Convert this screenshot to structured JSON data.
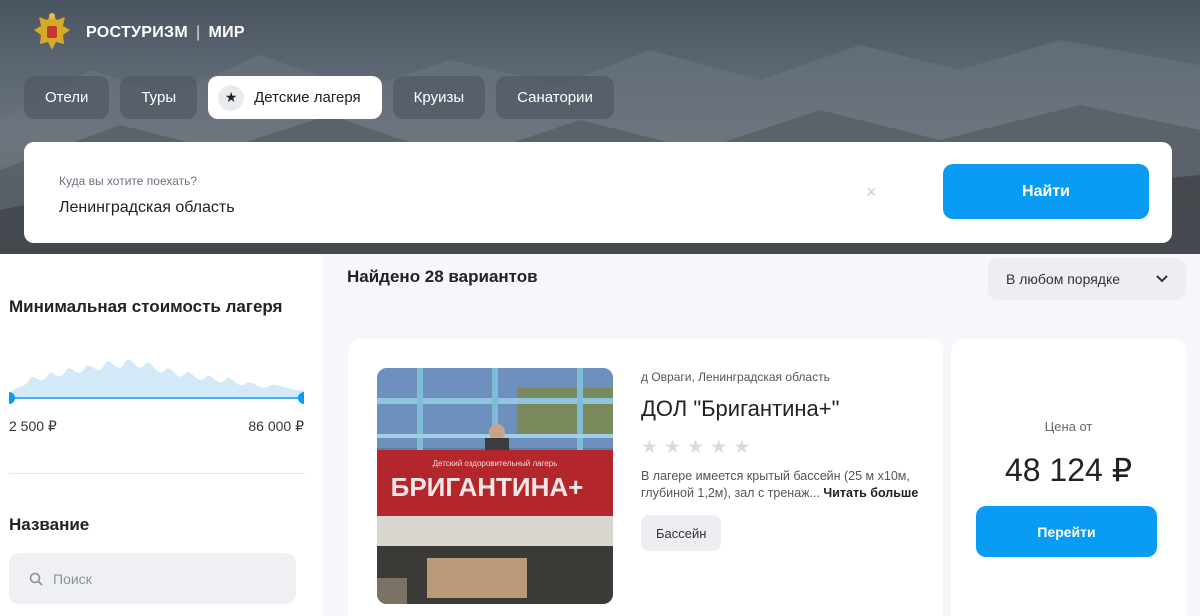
{
  "brand": {
    "name": "РОСТУРИЗМ",
    "partner": "МИР",
    "separator": "|"
  },
  "tabs": [
    {
      "label": "Отели",
      "active": false
    },
    {
      "label": "Туры",
      "active": false
    },
    {
      "label": "Детские лагеря",
      "active": true
    },
    {
      "label": "Круизы",
      "active": false
    },
    {
      "label": "Санатории",
      "active": false
    }
  ],
  "search": {
    "label": "Куда вы хотите поехать?",
    "value": "Ленинградская область",
    "clear_icon": "close-icon",
    "button_label": "Найти"
  },
  "filters": {
    "price_title": "Минимальная стоимость лагеря",
    "price_min": "2 500 ₽",
    "price_max": "86 000 ₽",
    "name_title": "Название",
    "name_placeholder": "Поиск"
  },
  "results": {
    "found_text": "Найдено 28 вариантов",
    "sort_label": "В любом порядке"
  },
  "card": {
    "location": "д Овраги, Ленинградская область",
    "name": "ДОЛ \"Бригантина+\"",
    "rating": 0,
    "rating_max": 5,
    "description": "В лагере имеется крытый бассейн (25 м х10м, глубиной 1,2м), зал с тренаж...",
    "read_more": "Читать больше",
    "tag": "Бассейн",
    "photo_sign_top": "Детский оздоровительный лагерь",
    "photo_sign_main": "БРИГАНТИНА+",
    "price_label": "Цена от",
    "price_value": "48 124 ₽",
    "go_label": "Перейти"
  },
  "colors": {
    "accent": "#0a9cf5",
    "page_bg": "#f5f7fa"
  }
}
